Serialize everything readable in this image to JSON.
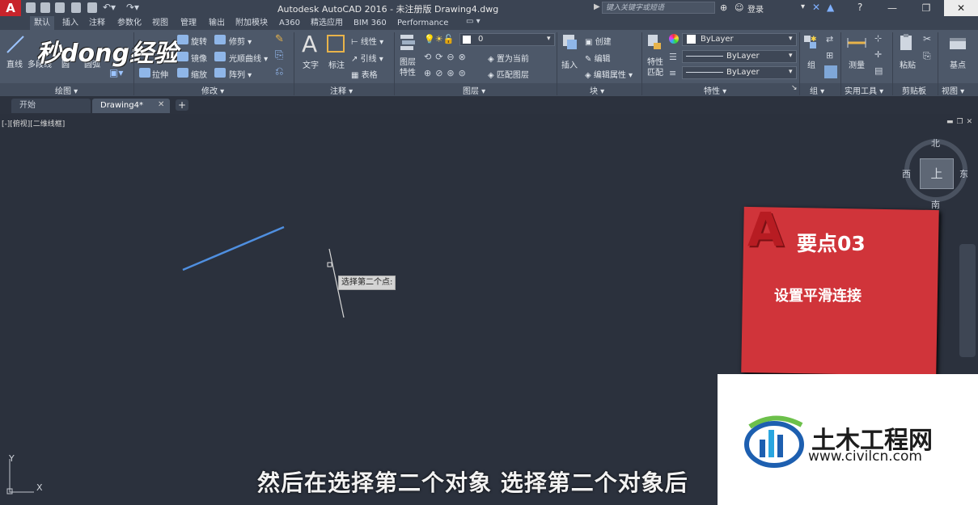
{
  "title_bar": {
    "app_title": "Autodesk AutoCAD 2016 - 未注册版    Drawing4.dwg",
    "logo_letter": "A",
    "search_placeholder": "键入关键字或短语",
    "login_label": "登录"
  },
  "ribbon_tabs": [
    "默认",
    "插入",
    "注释",
    "参数化",
    "视图",
    "管理",
    "输出",
    "附加模块",
    "A360",
    "精选应用",
    "BIM 360",
    "Performance"
  ],
  "ribbon": {
    "draw": {
      "panel": "绘图",
      "line": "直线",
      "polyline": "多段线",
      "circle": "圆",
      "arc": "圆弧"
    },
    "modify": {
      "panel": "修改",
      "rotate": "旋转",
      "trim": "修剪",
      "mirror": "镜像",
      "fillet": "光顺曲线",
      "stretch": "拉伸",
      "scale": "缩放",
      "array": "阵列"
    },
    "annotation": {
      "panel": "注释",
      "text": "文字",
      "dimension": "标注",
      "linear": "线性",
      "leader": "引线",
      "table": "表格"
    },
    "layers": {
      "panel": "图层",
      "layer_props": "图层\n特性",
      "current_layer": "0",
      "set_current": "置为当前",
      "match_layer": "匹配图层"
    },
    "block": {
      "panel": "块",
      "insert": "插入",
      "create": "创建",
      "edit": "编辑",
      "edit_attr": "编辑属性"
    },
    "properties": {
      "panel": "特性",
      "match": "特性\n匹配",
      "color": "ByLayer",
      "linetype": "ByLayer",
      "lineweight": "ByLayer"
    },
    "groups": {
      "panel": "组",
      "group": "组"
    },
    "utilities": {
      "panel": "实用工具",
      "measure": "测量"
    },
    "clipboard": {
      "panel": "剪贴板",
      "paste": "粘贴"
    },
    "view": {
      "panel": "视图",
      "base": "基点"
    }
  },
  "doc_tabs": [
    "开始",
    "Drawing4*"
  ],
  "viewport": {
    "label": "[-][俯视][二维线框]",
    "tooltip": "选择第二个点:",
    "compass": {
      "north": "北",
      "south": "南",
      "east": "东",
      "west": "西",
      "top": "上"
    },
    "ucs_x": "X",
    "ucs_y": "Y"
  },
  "overlay": {
    "card_title": "要点03",
    "card_subtitle": "设置平滑连接",
    "brand_title": "土木工程网",
    "brand_url": "www.civilcn.com",
    "watermark": "秒dong经验",
    "caption": "然后在选择第二个对象 选择第二个对象后"
  },
  "colors": {
    "accent": "#c8242b",
    "canvas": "#2b313d",
    "ribbon": "#4d5869",
    "line": "#4f8fe0"
  }
}
